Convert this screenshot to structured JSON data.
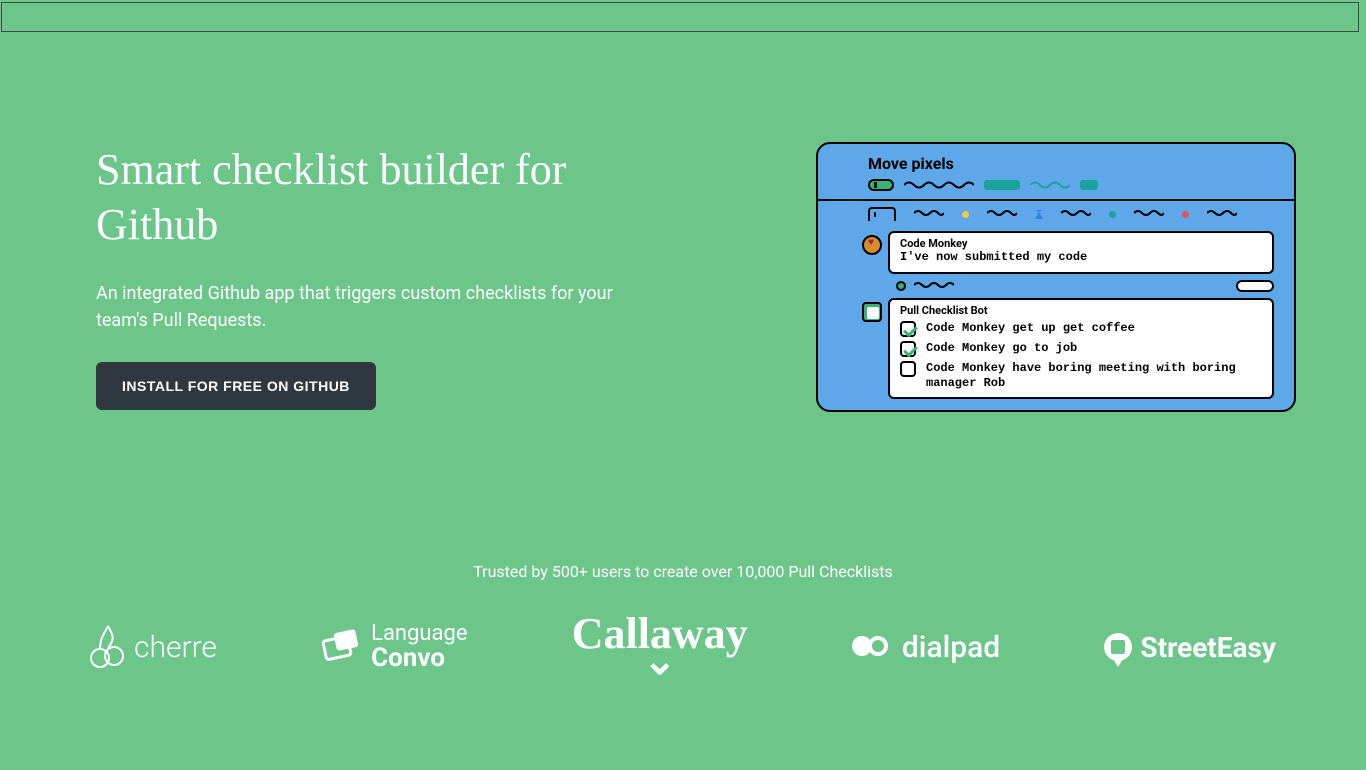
{
  "hero": {
    "title": "Smart checklist builder for Github",
    "subtitle": "An integrated Github app that triggers custom checklists for your team's Pull Requests.",
    "cta_label": "INSTALL FOR FREE ON GITHUB"
  },
  "illustration": {
    "window_title": "Move pixels",
    "comment": {
      "author": "Code Monkey",
      "body": "I've now submitted my code"
    },
    "bot": {
      "author": "Pull Checklist Bot",
      "items": [
        {
          "checked": true,
          "text": "Code Monkey get up get coffee"
        },
        {
          "checked": true,
          "text": "Code Monkey go to job"
        },
        {
          "checked": false,
          "text": "Code Monkey have boring meeting with boring manager Rob"
        }
      ]
    }
  },
  "trusted": {
    "text": "Trusted by 500+ users to create over 10,000 Pull Checklists",
    "logos": {
      "cherre": "cherre",
      "language_convo_top": "Language",
      "language_convo_bottom": "Convo",
      "callaway": "Callaway",
      "dialpad": "dialpad",
      "streeteasy": "StreetEasy"
    }
  }
}
